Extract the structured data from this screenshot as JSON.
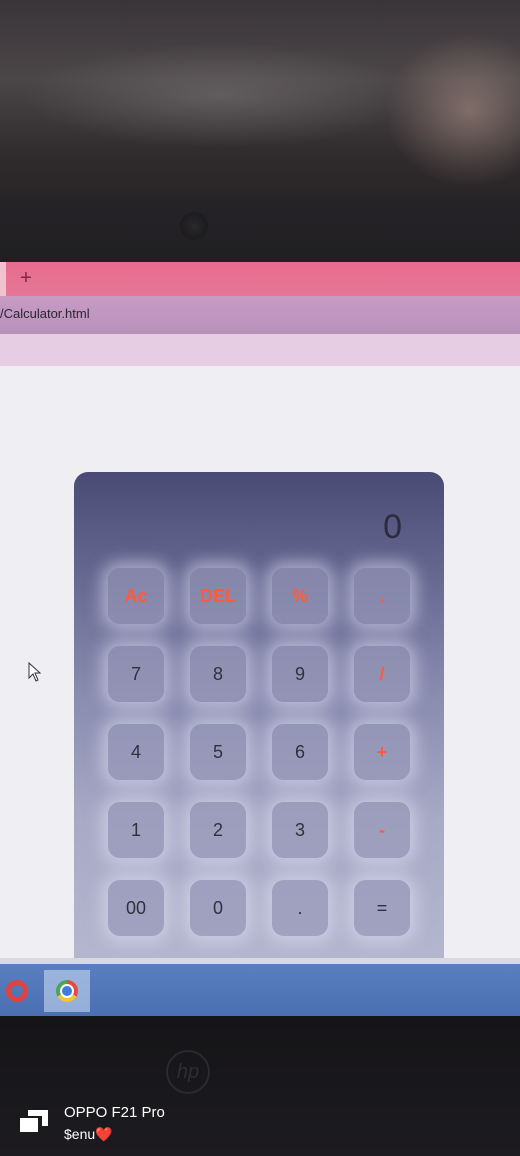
{
  "browser": {
    "new_tab_label": "+",
    "url": "/Calculator.html"
  },
  "calculator": {
    "display_value": "0",
    "rows": [
      [
        {
          "label": "Ac",
          "type": "op"
        },
        {
          "label": "DEL",
          "type": "op"
        },
        {
          "label": "%",
          "type": "op"
        },
        {
          "label": ".",
          "type": "op"
        }
      ],
      [
        {
          "label": "7",
          "type": "num"
        },
        {
          "label": "8",
          "type": "num"
        },
        {
          "label": "9",
          "type": "num"
        },
        {
          "label": "/",
          "type": "op"
        }
      ],
      [
        {
          "label": "4",
          "type": "num"
        },
        {
          "label": "5",
          "type": "num"
        },
        {
          "label": "6",
          "type": "num"
        },
        {
          "label": "+",
          "type": "op"
        }
      ],
      [
        {
          "label": "1",
          "type": "num"
        },
        {
          "label": "2",
          "type": "num"
        },
        {
          "label": "3",
          "type": "num"
        },
        {
          "label": "-",
          "type": "op"
        }
      ],
      [
        {
          "label": "00",
          "type": "num"
        },
        {
          "label": "0",
          "type": "num"
        },
        {
          "label": ".",
          "type": "num"
        },
        {
          "label": "=",
          "type": "num"
        }
      ]
    ]
  },
  "taskbar": {
    "items": [
      "opera-icon",
      "chrome-icon"
    ]
  },
  "laptop": {
    "logo": "hp"
  },
  "watermark": {
    "model": "OPPO F21 Pro",
    "user": "$enu❤️"
  },
  "colors": {
    "operator": "#ff5a3c",
    "tabbar": "#e86b8e",
    "addressbar": "#c79bc4"
  }
}
